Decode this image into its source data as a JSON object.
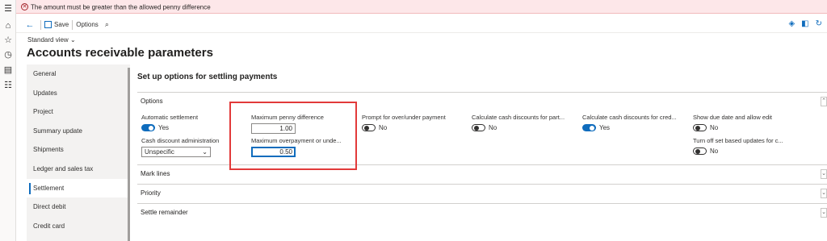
{
  "rail": {
    "icons": [
      "hamburger-icon",
      "home-icon",
      "star-icon",
      "clock-icon",
      "module-icon",
      "list-icon"
    ]
  },
  "error": {
    "message": "The amount must be greater than the allowed penny difference",
    "color": "#a4262c"
  },
  "toolbar": {
    "save_label": "Save",
    "options_label": "Options"
  },
  "page": {
    "view_label": "Standard view",
    "title": "Accounts receivable parameters",
    "section_title": "Set up options for settling payments"
  },
  "nav": {
    "items": [
      {
        "label": "General"
      },
      {
        "label": "Updates"
      },
      {
        "label": "Project"
      },
      {
        "label": "Summary update"
      },
      {
        "label": "Shipments"
      },
      {
        "label": "Ledger and sales tax"
      },
      {
        "label": "Settlement"
      },
      {
        "label": "Direct debit"
      },
      {
        "label": "Credit card"
      }
    ],
    "active": "Settlement"
  },
  "options": {
    "header": "Options",
    "automatic_settlement": {
      "label": "Automatic settlement",
      "value": "Yes"
    },
    "cash_discount_admin": {
      "label": "Cash discount administration",
      "value": "Unspecific"
    },
    "max_penny": {
      "label": "Maximum penny difference",
      "value": "1.00"
    },
    "max_overpayment": {
      "label": "Maximum overpayment or unde...",
      "value": "0.50"
    },
    "prompt_over_under": {
      "label": "Prompt for over/under payment",
      "value": "No"
    },
    "calc_cash_part": {
      "label": "Calculate cash discounts for part...",
      "value": "No"
    },
    "calc_cash_cred": {
      "label": "Calculate cash discounts for cred...",
      "value": "Yes"
    },
    "show_due_date": {
      "label": "Show due date and allow edit",
      "value": "No"
    },
    "turn_off_set": {
      "label": "Turn off set based updates for c...",
      "value": "No"
    }
  },
  "fasttabs": {
    "mark_lines": "Mark lines",
    "priority": "Priority",
    "settle_remainder": "Settle remainder"
  },
  "colors": {
    "accent": "#0f6cbd",
    "highlight": "#e23a3a"
  }
}
